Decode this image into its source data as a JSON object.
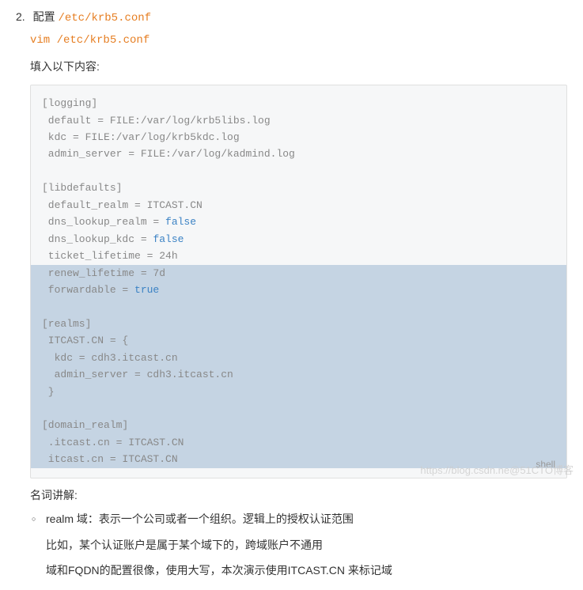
{
  "step": {
    "number": "2.",
    "label": "配置",
    "path": "/etc/krb5.conf"
  },
  "command": "vim /etc/krb5.conf",
  "fillText": "填入以下内容:",
  "code": {
    "logging_header": "[logging]",
    "logging_default": " default = FILE:/var/log/krb5libs.log",
    "logging_kdc": " kdc = FILE:/var/log/krb5kdc.log",
    "logging_admin": " admin_server = FILE:/var/log/kadmind.log",
    "libdefaults_header": "[libdefaults]",
    "libdefaults_realm": " default_realm = ITCAST.CN",
    "libdefaults_dns_realm_pre": " dns_lookup_realm = ",
    "libdefaults_dns_realm_val": "false",
    "libdefaults_dns_kdc_pre": " dns_lookup_kdc = ",
    "libdefaults_dns_kdc_val": "false",
    "libdefaults_ticket": " ticket_lifetime = 24h",
    "libdefaults_renew": " renew_lifetime = 7d",
    "libdefaults_forward_pre": " forwardable = ",
    "libdefaults_forward_val": "true",
    "realms_header": "[realms]",
    "realms_open": " ITCAST.CN = {",
    "realms_kdc": "  kdc = cdh3.itcast.cn",
    "realms_admin": "  admin_server = cdh3.itcast.cn",
    "realms_close": " }",
    "domain_header": "[domain_realm]",
    "domain_dot": " .itcast.cn = ITCAST.CN",
    "domain_plain": " itcast.cn = ITCAST.CN",
    "langTag": "shell"
  },
  "glossary": {
    "title": "名词讲解:",
    "realm": "realm 域：表示一个公司或者一个组织。逻辑上的授权认证范围",
    "para1": "比如，某个认证账户是属于某个域下的，跨域账户不通用",
    "para2": "域和FQDN的配置很像，使用大写，本次演示使用ITCAST.CN 来标记域"
  },
  "watermark": "https://blog.csdn.ne@51CTO博客"
}
